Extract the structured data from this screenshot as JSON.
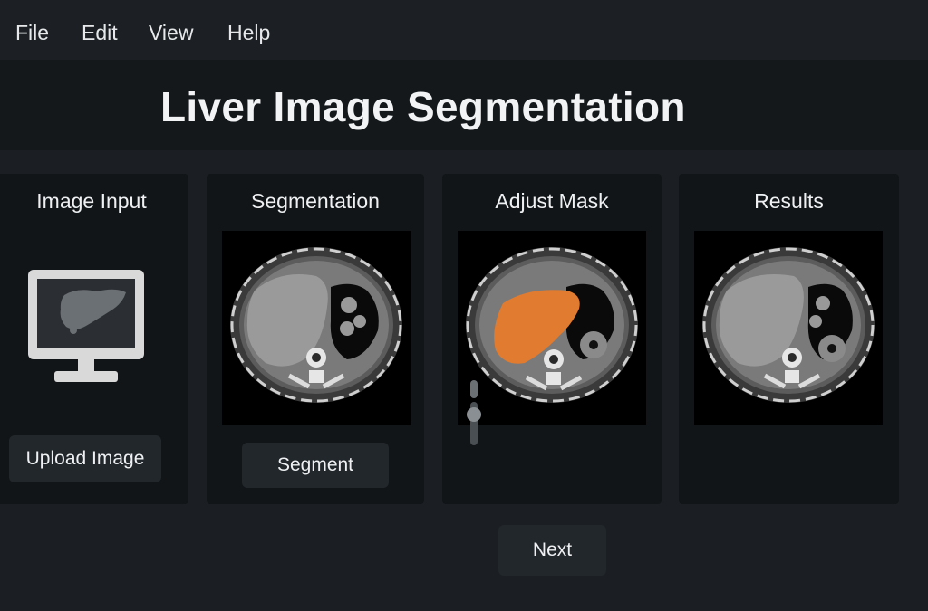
{
  "menu": {
    "items": [
      "File",
      "Edit",
      "View",
      "Help"
    ]
  },
  "header": {
    "title": "Liver Image Segmentation"
  },
  "panels": {
    "input": {
      "title": "Image Input",
      "button": "Upload Image",
      "icon": "monitor-liver-icon"
    },
    "segmentation": {
      "title": "Segmentation",
      "button": "Segment"
    },
    "adjust": {
      "title": "Adjust Mask",
      "mask_color": "#e07b2f"
    },
    "results": {
      "title": "Results"
    }
  },
  "footer": {
    "next_label": "Next"
  },
  "colors": {
    "background": "#1b1f23",
    "panel": "#121518",
    "button": "#22272c",
    "text": "#eef0f2",
    "mask": "#e07b2f"
  }
}
